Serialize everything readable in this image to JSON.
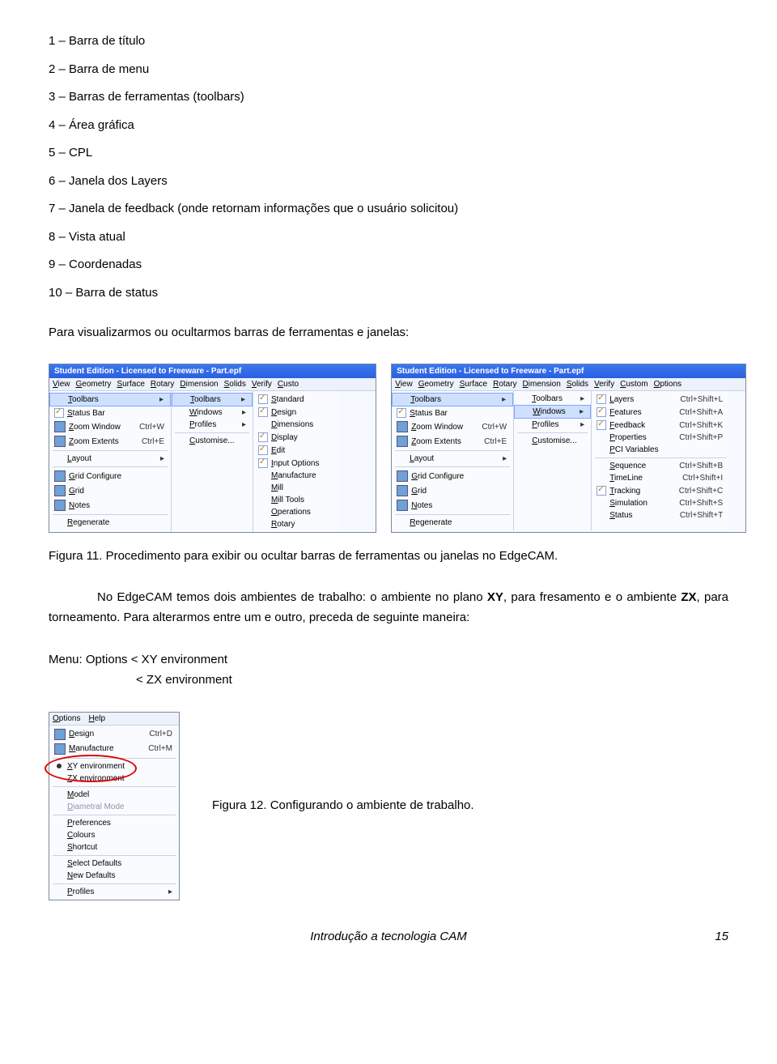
{
  "list": [
    "1 – Barra de título",
    "2 – Barra de menu",
    "3 – Barras de ferramentas (toolbars)",
    "4 – Área gráfica",
    "5 – CPL",
    "6 – Janela dos Layers",
    "7 – Janela de feedback (onde retornam informações que o usuário solicitou)",
    "8 – Vista atual",
    "9 – Coordenadas",
    "10 – Barra de status"
  ],
  "para1": "Para visualizarmos ou ocultarmos barras de ferramentas e janelas:",
  "fig11": "Figura 11. Procedimento para exibir ou ocultar barras de ferramentas ou janelas no EdgeCAM.",
  "para2a": "No EdgeCAM temos dois ambientes de trabalho: o ambiente no plano ",
  "para2b": ", para fresamento e o ambiente ",
  "para2c": ", para torneamento. Para alterarmos entre um e outro, preceda de seguinte maneira:",
  "xy": "XY",
  "zx": "ZX",
  "menu1": "Menu: Options   < XY environment",
  "menu2": "< ZX environment",
  "fig12": "Figura 12. Configurando o ambiente de trabalho.",
  "footer_title": "Introdução a tecnologia CAM",
  "footer_page": "15",
  "mock": {
    "title": "Student Edition - Licensed to Freeware - Part.epf",
    "menusA": [
      "View",
      "Geometry",
      "Surface",
      "Rotary",
      "Dimension",
      "Solids",
      "Verify",
      "Custo"
    ],
    "menusB": [
      "View",
      "Geometry",
      "Surface",
      "Rotary",
      "Dimension",
      "Solids",
      "Verify",
      "Custom",
      "Options"
    ],
    "viewPanel": [
      {
        "label": "Toolbars",
        "hl": true,
        "arrow": true
      },
      {
        "label": "Status Bar",
        "chk": true
      },
      {
        "label": "Zoom Window",
        "shortcut": "Ctrl+W",
        "icon": true
      },
      {
        "label": "Zoom Extents",
        "shortcut": "Ctrl+E",
        "icon": true
      },
      {
        "sep": true
      },
      {
        "label": "Layout",
        "arrow": true
      },
      {
        "sep": true
      },
      {
        "label": "Grid Configure",
        "icon": true
      },
      {
        "label": "Grid",
        "icon": true
      },
      {
        "label": "Notes",
        "icon": true
      },
      {
        "sep": true
      },
      {
        "label": "Regenerate"
      }
    ],
    "subPanel": [
      {
        "label": "Toolbars",
        "hl": true,
        "arrow": true
      },
      {
        "label": "Windows",
        "arrow": true
      },
      {
        "label": "Profiles",
        "arrow": true
      },
      {
        "sep": true
      },
      {
        "label": "Customise..."
      }
    ],
    "tbPanel": [
      {
        "label": "Standard",
        "chk": true
      },
      {
        "label": "Design",
        "chk": true
      },
      {
        "label": "Dimensions"
      },
      {
        "label": "Display",
        "chk": true
      },
      {
        "label": "Edit",
        "chk": true
      },
      {
        "label": "Input Options",
        "chk": true
      },
      {
        "label": "Manufacture"
      },
      {
        "label": "Mill"
      },
      {
        "label": "Mill Tools"
      },
      {
        "label": "Operations"
      },
      {
        "label": "Rotary"
      }
    ],
    "winPanel": [
      {
        "label": "Layers",
        "shortcut": "Ctrl+Shift+L",
        "chk": true
      },
      {
        "label": "Features",
        "shortcut": "Ctrl+Shift+A",
        "chk": true
      },
      {
        "label": "Feedback",
        "shortcut": "Ctrl+Shift+K",
        "chk": true
      },
      {
        "label": "Properties",
        "shortcut": "Ctrl+Shift+P"
      },
      {
        "label": "PCI Variables"
      },
      {
        "sep": true
      },
      {
        "label": "Sequence",
        "shortcut": "Ctrl+Shift+B"
      },
      {
        "label": "TimeLine",
        "shortcut": "Ctrl+Shift+I"
      },
      {
        "label": "Tracking",
        "shortcut": "Ctrl+Shift+C",
        "chk": true
      },
      {
        "label": "Simulation",
        "shortcut": "Ctrl+Shift+S"
      },
      {
        "label": "Status",
        "shortcut": "Ctrl+Shift+T"
      }
    ],
    "subPanelB": [
      {
        "label": "Toolbars",
        "arrow": true
      },
      {
        "label": "Windows",
        "hl": true,
        "arrow": true
      },
      {
        "label": "Profiles",
        "arrow": true
      },
      {
        "sep": true
      },
      {
        "label": "Customise..."
      }
    ],
    "optMenu": [
      "Options",
      "Help"
    ],
    "optPanel": [
      {
        "label": "Design",
        "shortcut": "Ctrl+D",
        "icon": true
      },
      {
        "label": "Manufacture",
        "shortcut": "Ctrl+M",
        "icon": true
      },
      {
        "sep": true
      },
      {
        "label": "XY environment",
        "dot": true
      },
      {
        "label": "ZX environment"
      },
      {
        "sep": true
      },
      {
        "label": "Model"
      },
      {
        "label": "Diametral Mode",
        "dim": true
      },
      {
        "sep": true
      },
      {
        "label": "Preferences"
      },
      {
        "label": "Colours"
      },
      {
        "label": "Shortcut"
      },
      {
        "sep": true
      },
      {
        "label": "Select Defaults"
      },
      {
        "label": "New Defaults"
      },
      {
        "sep": true
      },
      {
        "label": "Profiles",
        "arrow": true
      }
    ]
  }
}
